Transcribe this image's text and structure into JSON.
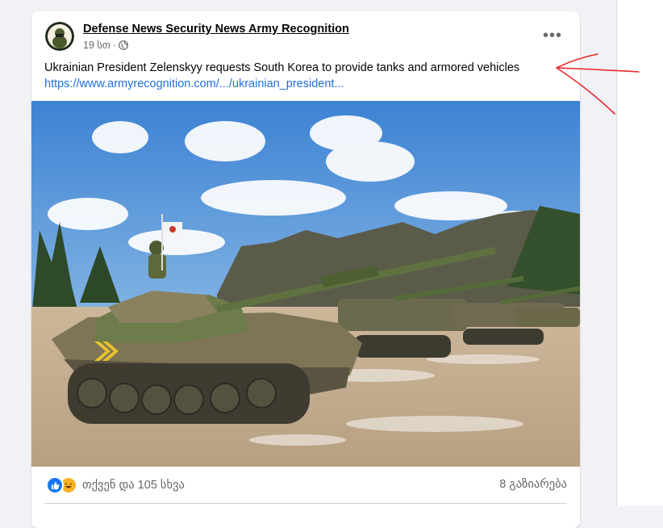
{
  "post": {
    "page_name": "Defense News Security News Army Recognition",
    "time": "19 სთ",
    "separator": "·",
    "privacy_icon": "globe-icon",
    "more_icon": "more-options-icon",
    "more_label": "•••",
    "text": "Ukrainian President Zelenskyy requests South Korea to provide tanks and armored vehicles",
    "link": "https://www.armyrecognition.com/.../ukrainian_president..."
  },
  "footer": {
    "reaction_icons": [
      "like-icon",
      "haha-icon"
    ],
    "reactions_text": "თქვენ და 105 სხვა",
    "shares_text": "8 გაზიარება"
  },
  "colors": {
    "link": "#216fdb",
    "like": "#1877f2",
    "haha": "#f7b125",
    "annotation": "#e8262a",
    "secondary_text": "#65676b"
  }
}
